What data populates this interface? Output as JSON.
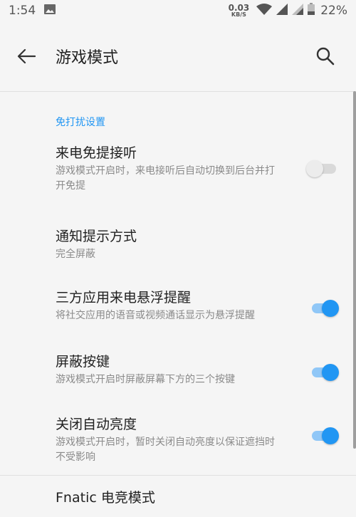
{
  "status_bar": {
    "time": "1:54",
    "net_speed_value": "0.03",
    "net_speed_unit": "KB/S",
    "battery": "22%",
    "icons": [
      "image-icon",
      "wifi-icon",
      "signal-icon",
      "signal-2-icon",
      "battery-icon"
    ]
  },
  "app_bar": {
    "title": "游戏模式",
    "back_icon": "arrow-left-icon",
    "search_icon": "search-icon"
  },
  "section": {
    "header": "免打扰设置"
  },
  "items": [
    {
      "title": "来电免提接听",
      "subtitle": "游戏模式开启时，来电接听后自动切换到后台并打开免提",
      "toggle": "off"
    },
    {
      "title": "通知提示方式",
      "subtitle": "完全屏蔽"
    },
    {
      "title": "三方应用来电悬浮提醒",
      "subtitle": "将社交应用的语音或视频通话显示为悬浮提醒",
      "toggle": "on"
    },
    {
      "title": "屏蔽按键",
      "subtitle": "游戏模式开启时屏蔽屏幕下方的三个按键",
      "toggle": "on"
    },
    {
      "title": "关闭自动亮度",
      "subtitle": "游戏模式开启时，暂时关闭自动亮度以保证遮挡时不受影响",
      "toggle": "on"
    },
    {
      "title": "Fnatic 电竞模式"
    }
  ],
  "colors": {
    "accent": "#2196f3",
    "accent_track": "#90c7f7",
    "background": "#f5f5f5",
    "subtitle": "#8a8a8a"
  }
}
